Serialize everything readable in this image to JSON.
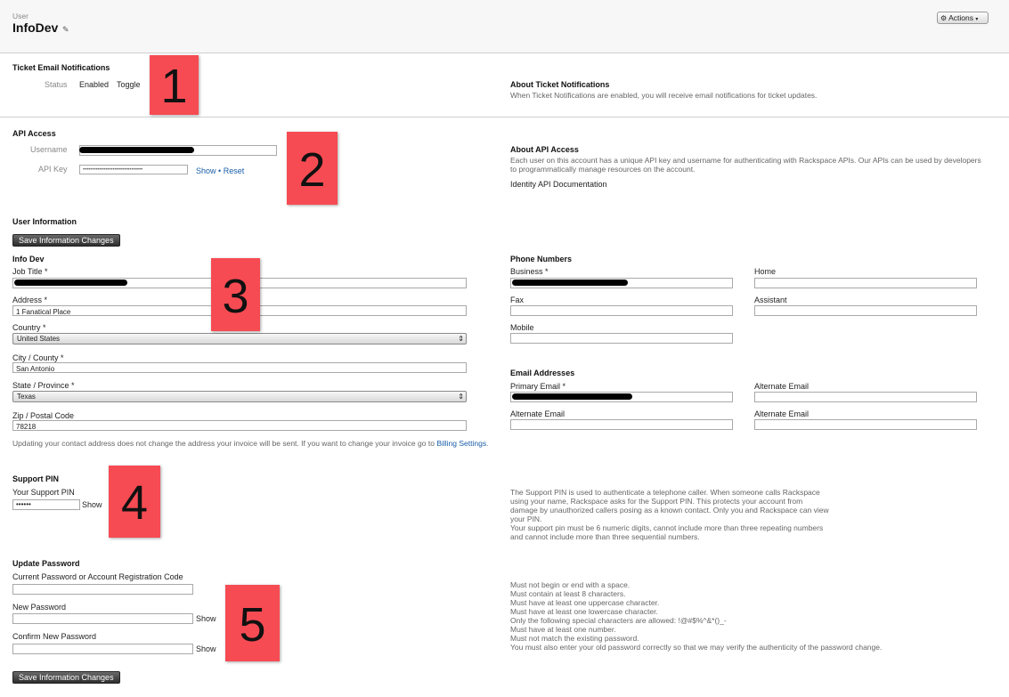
{
  "header": {
    "eyebrow": "User",
    "title": "InfoDev",
    "actions_label": "Actions",
    "actions_icon": "gear-icon",
    "edit_icon": "pencil-icon"
  },
  "ticket_notifications": {
    "title": "Ticket Email Notifications",
    "status_label": "Status",
    "status_value": "Enabled",
    "toggle_label": "Toggle",
    "about_title": "About Ticket Notifications",
    "about_text": "When Ticket Notifications are enabled, you will receive email notifications for ticket updates."
  },
  "api_access": {
    "title": "API Access",
    "username_label": "Username",
    "api_key_label": "API Key",
    "api_key_value": "••••••••••••••••••••••••••••••••",
    "show_label": "Show",
    "separator": "•",
    "reset_label": "Reset",
    "about_title": "About API Access",
    "about_text": "Each user on this account has a unique API key and username for authenticating with Rackspace APIs. Our APIs can be used by developers to programmatically manage resources on the account.",
    "doc_link": "Identity API Documentation"
  },
  "user_info": {
    "title": "User Information",
    "save_label": "Save Information Changes",
    "name_heading": "Info Dev",
    "job_title_label": "Job Title *",
    "address_label": "Address *",
    "address_value": "1 Fanatical Place",
    "country_label": "Country *",
    "country_value": "United States",
    "city_label": "City / County *",
    "city_value": "San Antonio",
    "state_label": "State / Province *",
    "state_value": "Texas",
    "zip_label": "Zip / Postal Code",
    "zip_value": "78218",
    "note_text": "Updating your contact address does not change the address your invoice will be sent. If you want to change your invoice go to",
    "note_link": "Billing Settings",
    "note_end": "."
  },
  "phone_numbers": {
    "title": "Phone Numbers",
    "business_label": "Business *",
    "home_label": "Home",
    "fax_label": "Fax",
    "assistant_label": "Assistant",
    "mobile_label": "Mobile"
  },
  "email_addresses": {
    "title": "Email Addresses",
    "primary_label": "Primary Email *",
    "alternate_label": "Alternate Email"
  },
  "support_pin": {
    "title": "Support PIN",
    "label": "Your Support PIN",
    "value": "••••••",
    "show_label": "Show",
    "desc": [
      "The Support PIN is used to authenticate a telephone caller. When someone calls Rackspace",
      "using your name, Rackspace asks for the Support PIN. This protects your account from",
      "damage by unauthorized callers posing as a known contact. Only you and Rackspace can view",
      "your PIN.",
      "Your support pin must be 6 numeric digits, cannot include more than three repeating numbers",
      "and cannot include more than three sequential numbers."
    ]
  },
  "update_password": {
    "title": "Update Password",
    "current_label": "Current Password or Account Registration Code",
    "new_label": "New Password",
    "confirm_label": "Confirm New Password",
    "show_label": "Show",
    "save_label": "Save Information Changes",
    "rules": [
      "Must not begin or end with a space.",
      "Must contain at least 8 characters.",
      "Must have at least one uppercase character.",
      "Must have at least one lowercase character.",
      "Only the following special characters are allowed: !@#$%^&*()_-",
      "Must have at least one number.",
      "Must not match the existing password.",
      "You must also enter your old password correctly so that we may verify the authenticity of the password change."
    ]
  },
  "annotations": [
    "1",
    "2",
    "3",
    "4",
    "5"
  ],
  "colors": {
    "link": "#1a5ea8",
    "badge": "#f74b53",
    "button_dark": "#3a3a3a",
    "redaction": "#000000"
  }
}
